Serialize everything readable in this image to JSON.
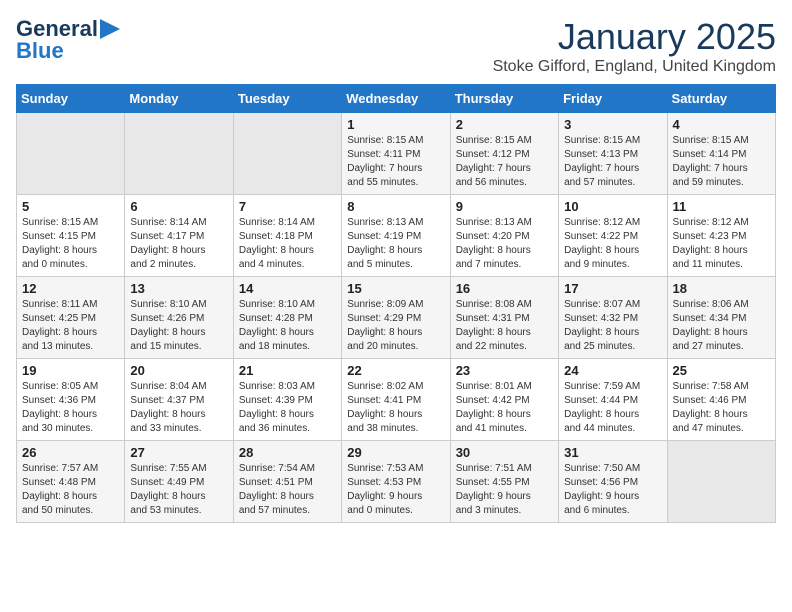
{
  "logo": {
    "line1": "General",
    "line2": "Blue"
  },
  "title": "January 2025",
  "location": "Stoke Gifford, England, United Kingdom",
  "days_of_week": [
    "Sunday",
    "Monday",
    "Tuesday",
    "Wednesday",
    "Thursday",
    "Friday",
    "Saturday"
  ],
  "weeks": [
    [
      {
        "day": "",
        "content": ""
      },
      {
        "day": "",
        "content": ""
      },
      {
        "day": "",
        "content": ""
      },
      {
        "day": "1",
        "content": "Sunrise: 8:15 AM\nSunset: 4:11 PM\nDaylight: 7 hours\nand 55 minutes."
      },
      {
        "day": "2",
        "content": "Sunrise: 8:15 AM\nSunset: 4:12 PM\nDaylight: 7 hours\nand 56 minutes."
      },
      {
        "day": "3",
        "content": "Sunrise: 8:15 AM\nSunset: 4:13 PM\nDaylight: 7 hours\nand 57 minutes."
      },
      {
        "day": "4",
        "content": "Sunrise: 8:15 AM\nSunset: 4:14 PM\nDaylight: 7 hours\nand 59 minutes."
      }
    ],
    [
      {
        "day": "5",
        "content": "Sunrise: 8:15 AM\nSunset: 4:15 PM\nDaylight: 8 hours\nand 0 minutes."
      },
      {
        "day": "6",
        "content": "Sunrise: 8:14 AM\nSunset: 4:17 PM\nDaylight: 8 hours\nand 2 minutes."
      },
      {
        "day": "7",
        "content": "Sunrise: 8:14 AM\nSunset: 4:18 PM\nDaylight: 8 hours\nand 4 minutes."
      },
      {
        "day": "8",
        "content": "Sunrise: 8:13 AM\nSunset: 4:19 PM\nDaylight: 8 hours\nand 5 minutes."
      },
      {
        "day": "9",
        "content": "Sunrise: 8:13 AM\nSunset: 4:20 PM\nDaylight: 8 hours\nand 7 minutes."
      },
      {
        "day": "10",
        "content": "Sunrise: 8:12 AM\nSunset: 4:22 PM\nDaylight: 8 hours\nand 9 minutes."
      },
      {
        "day": "11",
        "content": "Sunrise: 8:12 AM\nSunset: 4:23 PM\nDaylight: 8 hours\nand 11 minutes."
      }
    ],
    [
      {
        "day": "12",
        "content": "Sunrise: 8:11 AM\nSunset: 4:25 PM\nDaylight: 8 hours\nand 13 minutes."
      },
      {
        "day": "13",
        "content": "Sunrise: 8:10 AM\nSunset: 4:26 PM\nDaylight: 8 hours\nand 15 minutes."
      },
      {
        "day": "14",
        "content": "Sunrise: 8:10 AM\nSunset: 4:28 PM\nDaylight: 8 hours\nand 18 minutes."
      },
      {
        "day": "15",
        "content": "Sunrise: 8:09 AM\nSunset: 4:29 PM\nDaylight: 8 hours\nand 20 minutes."
      },
      {
        "day": "16",
        "content": "Sunrise: 8:08 AM\nSunset: 4:31 PM\nDaylight: 8 hours\nand 22 minutes."
      },
      {
        "day": "17",
        "content": "Sunrise: 8:07 AM\nSunset: 4:32 PM\nDaylight: 8 hours\nand 25 minutes."
      },
      {
        "day": "18",
        "content": "Sunrise: 8:06 AM\nSunset: 4:34 PM\nDaylight: 8 hours\nand 27 minutes."
      }
    ],
    [
      {
        "day": "19",
        "content": "Sunrise: 8:05 AM\nSunset: 4:36 PM\nDaylight: 8 hours\nand 30 minutes."
      },
      {
        "day": "20",
        "content": "Sunrise: 8:04 AM\nSunset: 4:37 PM\nDaylight: 8 hours\nand 33 minutes."
      },
      {
        "day": "21",
        "content": "Sunrise: 8:03 AM\nSunset: 4:39 PM\nDaylight: 8 hours\nand 36 minutes."
      },
      {
        "day": "22",
        "content": "Sunrise: 8:02 AM\nSunset: 4:41 PM\nDaylight: 8 hours\nand 38 minutes."
      },
      {
        "day": "23",
        "content": "Sunrise: 8:01 AM\nSunset: 4:42 PM\nDaylight: 8 hours\nand 41 minutes."
      },
      {
        "day": "24",
        "content": "Sunrise: 7:59 AM\nSunset: 4:44 PM\nDaylight: 8 hours\nand 44 minutes."
      },
      {
        "day": "25",
        "content": "Sunrise: 7:58 AM\nSunset: 4:46 PM\nDaylight: 8 hours\nand 47 minutes."
      }
    ],
    [
      {
        "day": "26",
        "content": "Sunrise: 7:57 AM\nSunset: 4:48 PM\nDaylight: 8 hours\nand 50 minutes."
      },
      {
        "day": "27",
        "content": "Sunrise: 7:55 AM\nSunset: 4:49 PM\nDaylight: 8 hours\nand 53 minutes."
      },
      {
        "day": "28",
        "content": "Sunrise: 7:54 AM\nSunset: 4:51 PM\nDaylight: 8 hours\nand 57 minutes."
      },
      {
        "day": "29",
        "content": "Sunrise: 7:53 AM\nSunset: 4:53 PM\nDaylight: 9 hours\nand 0 minutes."
      },
      {
        "day": "30",
        "content": "Sunrise: 7:51 AM\nSunset: 4:55 PM\nDaylight: 9 hours\nand 3 minutes."
      },
      {
        "day": "31",
        "content": "Sunrise: 7:50 AM\nSunset: 4:56 PM\nDaylight: 9 hours\nand 6 minutes."
      },
      {
        "day": "",
        "content": ""
      }
    ]
  ]
}
